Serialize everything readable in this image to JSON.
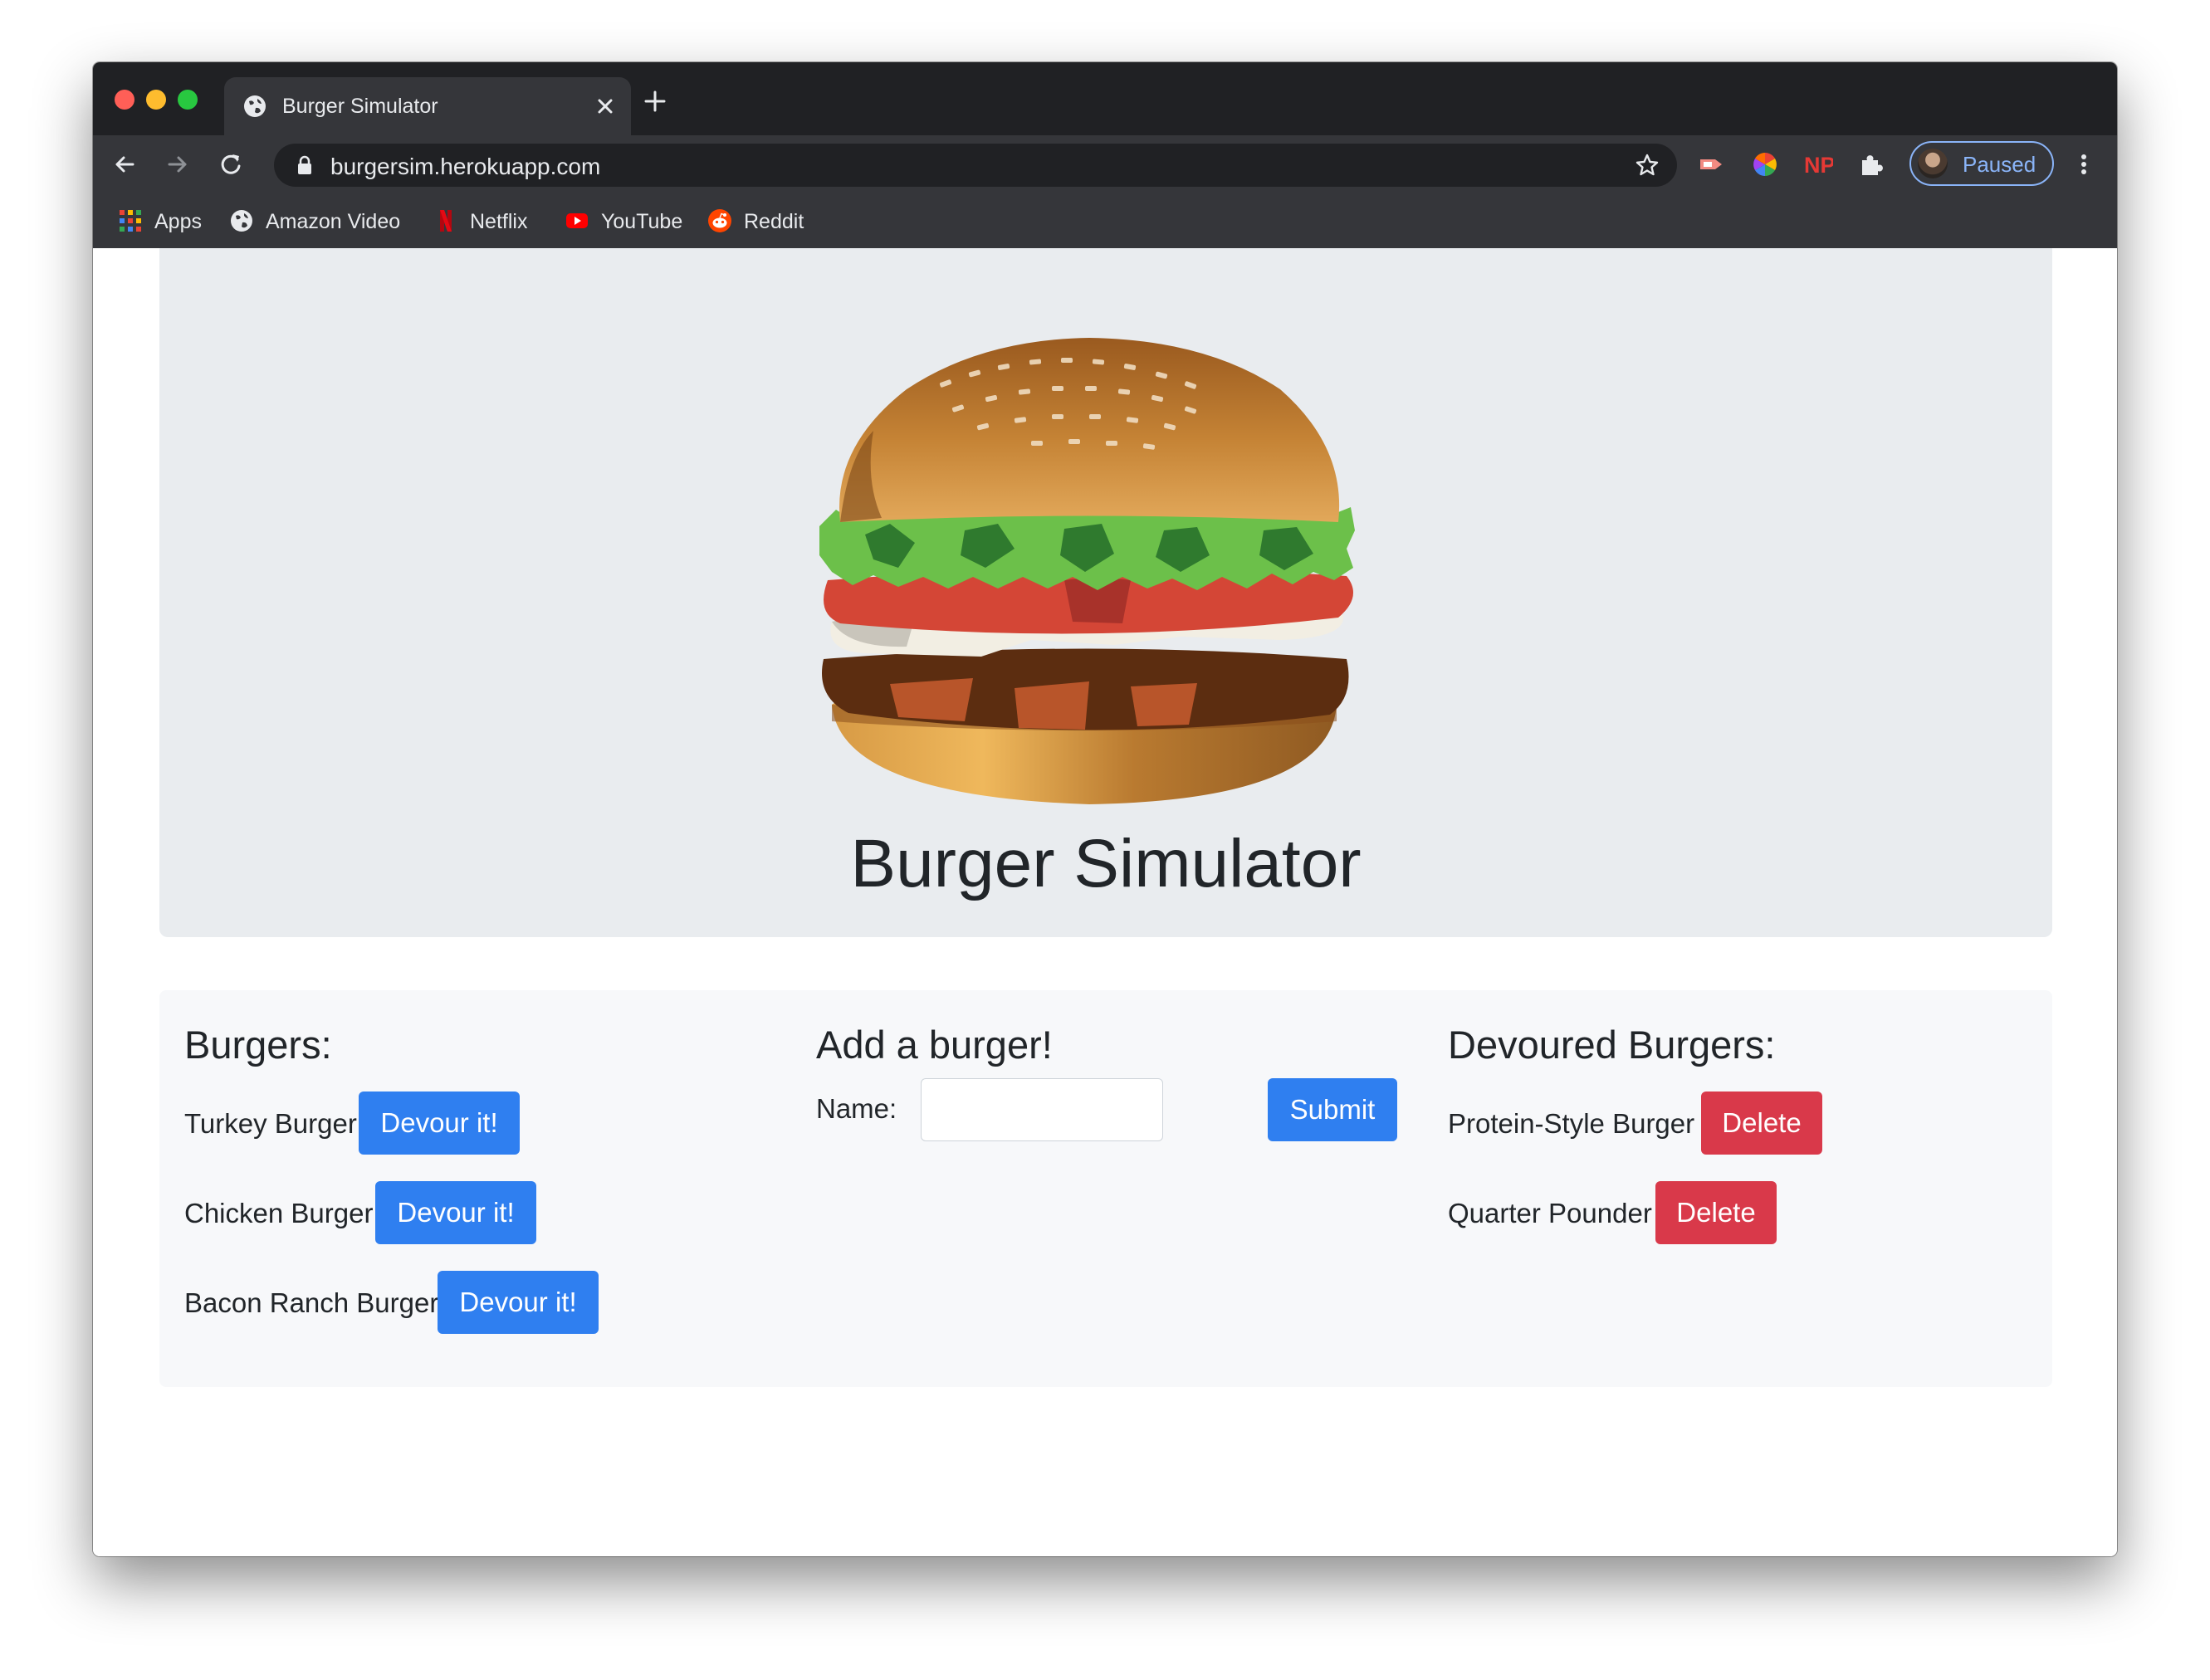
{
  "browser": {
    "tab_title": "Burger Simulator",
    "url": "burgersim.herokuapp.com",
    "profile_label": "Paused",
    "bookmarks": [
      {
        "label": "Apps",
        "icon": "apps-grid-icon"
      },
      {
        "label": "Amazon Video",
        "icon": "globe-icon"
      },
      {
        "label": "Netflix",
        "icon": "netflix-icon"
      },
      {
        "label": "YouTube",
        "icon": "youtube-icon"
      },
      {
        "label": "Reddit",
        "icon": "reddit-icon"
      }
    ],
    "extension_np_text": "NP"
  },
  "header": {
    "title": "Burger Simulator",
    "image": "burger-illustration"
  },
  "burgers": {
    "heading": "Burgers:",
    "items": [
      {
        "name": "Turkey Burger",
        "button": "Devour it!"
      },
      {
        "name": "Chicken Burger",
        "button": "Devour it!"
      },
      {
        "name": "Bacon Ranch Burger",
        "button": "Devour it!"
      }
    ]
  },
  "add_form": {
    "heading": "Add a burger!",
    "name_label": "Name:",
    "name_value": "",
    "submit_label": "Submit"
  },
  "devoured": {
    "heading": "Devoured Burgers:",
    "items": [
      {
        "name": "Protein-Style Burger",
        "button": "Delete"
      },
      {
        "name": "Quarter Pounder",
        "button": "Delete"
      }
    ]
  },
  "colors": {
    "primary_button": "#2f7ff0",
    "danger_button": "#d9394a",
    "jumbotron_bg": "#e9ecef",
    "chrome_dark": "#202124",
    "chrome_toolbar": "#35363a"
  }
}
